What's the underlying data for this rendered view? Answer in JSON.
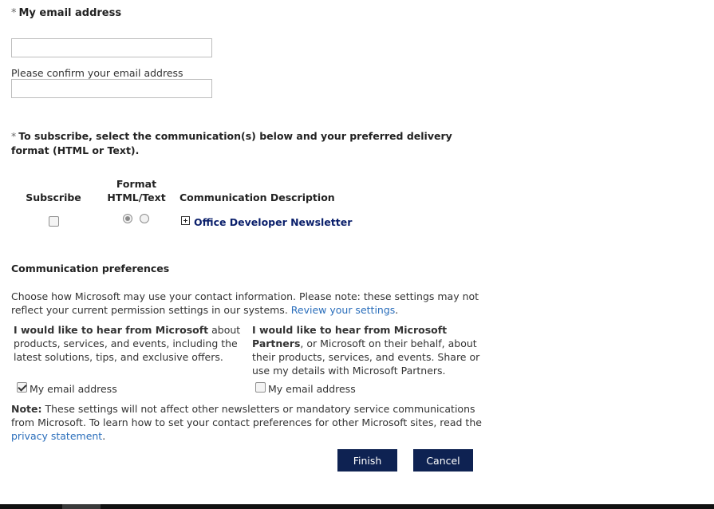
{
  "email": {
    "required_mark": "*",
    "label": "My email address",
    "value": "",
    "confirm_label": "Please confirm your email address",
    "confirm_value": ""
  },
  "subscribe": {
    "required_mark": "*",
    "heading": "To subscribe, select the communication(s) below and your preferred delivery format (HTML or Text).",
    "columns": {
      "subscribe": "Subscribe",
      "format_line1": "Format",
      "format_line2": "HTML/Text",
      "description": "Communication Description"
    },
    "items": [
      {
        "name": "Office Developer Newsletter",
        "subscribed": false,
        "format": "HTML"
      }
    ]
  },
  "preferences": {
    "heading": "Communication preferences",
    "intro": "Choose how Microsoft may use your contact information. Please note: these settings may not reflect your current permission settings in our systems.",
    "review_link": "Review your settings",
    "review_suffix": ".",
    "microsoft": {
      "bold": "I would like to hear from Microsoft",
      "rest": " about products, services, and events, including the latest solutions, tips, and exclusive offers.",
      "option_label": "My email address",
      "checked": true
    },
    "partners": {
      "bold": "I would like to hear from Microsoft Partners",
      "rest": ", or Microsoft on their behalf, about their products, services, and events. Share or use my details with Microsoft Partners.",
      "option_label": "My email address",
      "checked": false
    },
    "note_label": "Note:",
    "note_text": " These settings will not affect other newsletters or mandatory service communications from Microsoft. To learn how to set your contact preferences for other Microsoft sites, read the ",
    "privacy_link": "privacy statement",
    "note_suffix": "."
  },
  "buttons": {
    "finish": "Finish",
    "cancel": "Cancel"
  },
  "colors": {
    "button_bg": "#0e2252",
    "link": "#2a6ebb",
    "newsletter_link": "#0a1f6b"
  }
}
